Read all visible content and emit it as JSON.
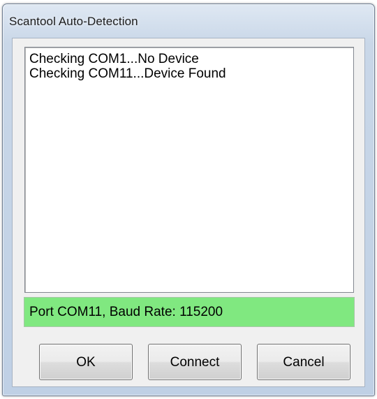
{
  "window": {
    "title": "Scantool Auto-Detection"
  },
  "log": {
    "lines": [
      "Checking COM1...No Device",
      "Checking COM11...Device Found"
    ]
  },
  "status": {
    "text": "Port COM11, Baud Rate: 115200",
    "color": "#80e880"
  },
  "buttons": {
    "ok_label": "OK",
    "connect_label": "Connect",
    "cancel_label": "Cancel"
  }
}
